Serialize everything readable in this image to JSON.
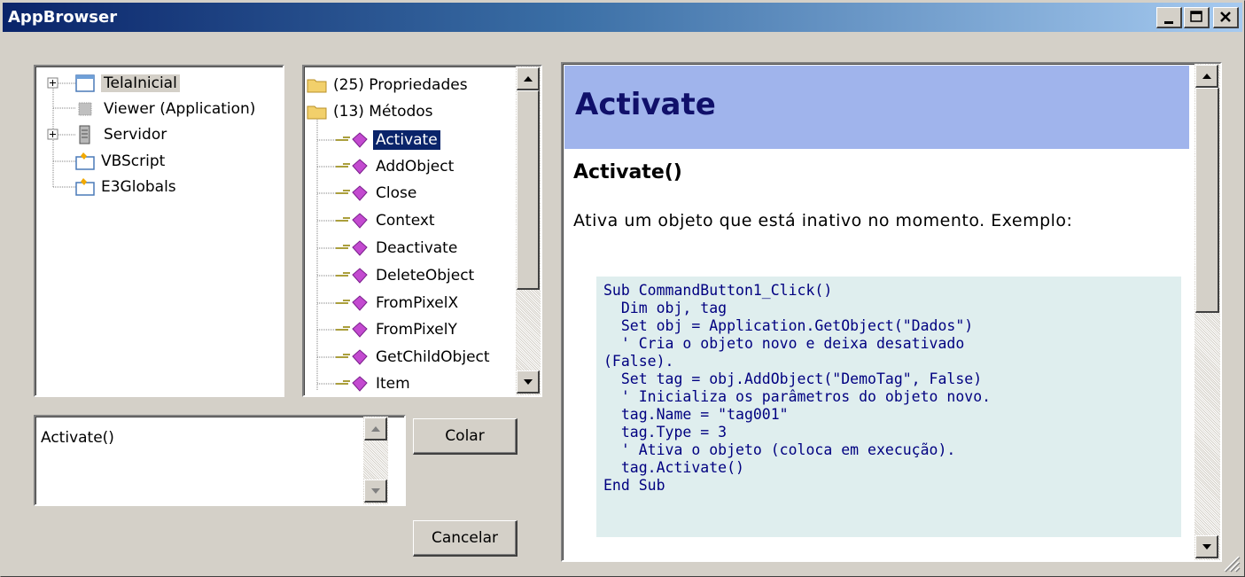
{
  "window": {
    "title": "AppBrowser"
  },
  "object_tree": {
    "items": [
      {
        "label": "TelaInicial",
        "icon": "screen-icon",
        "expander": "+",
        "selected": true
      },
      {
        "label": "Viewer (Application)",
        "icon": "viewer-icon",
        "expander": ""
      },
      {
        "label": "Servidor",
        "icon": "server-icon",
        "expander": "+"
      },
      {
        "label": "VBScript",
        "icon": "library-icon",
        "expander": ""
      },
      {
        "label": "E3Globals",
        "icon": "library-icon",
        "expander": ""
      }
    ]
  },
  "member_list": {
    "folders": [
      {
        "label": "(25) Propriedades"
      },
      {
        "label": "(13) Métodos"
      }
    ],
    "methods": [
      "Activate",
      "AddObject",
      "Close",
      "Context",
      "Deactivate",
      "DeleteObject",
      "FromPixelX",
      "FromPixelY",
      "GetChildObject",
      "Item"
    ],
    "selected": "Activate"
  },
  "syntax_box": {
    "value": "Activate()"
  },
  "buttons": {
    "paste": "Colar",
    "cancel": "Cancelar"
  },
  "help": {
    "title": "Activate",
    "signature": "Activate()",
    "description": "Ativa um objeto que está inativo no momento. Exemplo:",
    "code": "Sub CommandButton1_Click()\n  Dim obj, tag\n  Set obj = Application.GetObject(\"Dados\")\n  ' Cria o objeto novo e deixa desativado\n(False).\n  Set tag = obj.AddObject(\"DemoTag\", False)\n  ' Inicializa os parâmetros do objeto novo.\n  tag.Name = \"tag001\"\n  tag.Type = 3\n  ' Ativa o objeto (coloca em execução).\n  tag.Activate()\nEnd Sub",
    "header_color": "#a0b4ec",
    "code_bg_color": "#dfeeee",
    "code_text_color": "#000080"
  }
}
